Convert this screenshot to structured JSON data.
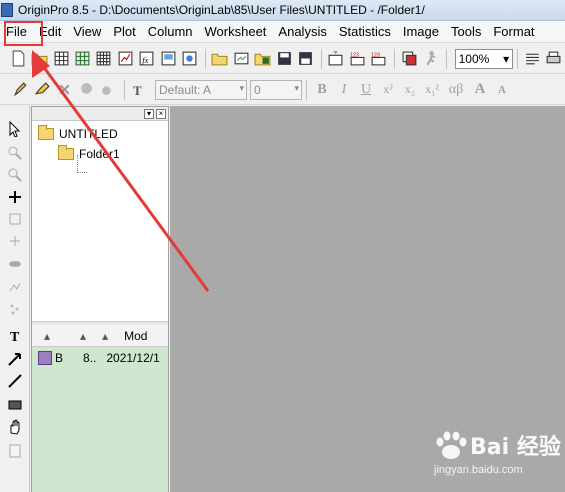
{
  "window": {
    "title": "OriginPro 8.5 - D:\\Documents\\OriginLab\\85\\User Files\\UNTITLED - /Folder1/"
  },
  "menu": {
    "items": [
      "File",
      "Edit",
      "View",
      "Plot",
      "Column",
      "Worksheet",
      "Analysis",
      "Statistics",
      "Image",
      "Tools",
      "Format"
    ]
  },
  "toolbar": {
    "zoom_value": "100%"
  },
  "format_toolbar": {
    "font_value": "Default: A",
    "size_value": "0",
    "bold": "B",
    "italic": "I",
    "underline": "U",
    "superscript": "x²",
    "subscript": "x₂",
    "supsub": "x₁²",
    "greek": "αβ",
    "font_size_up": "A",
    "font_size_down": "A"
  },
  "explorer": {
    "root": "UNTITLED",
    "folder": "Folder1",
    "columns": [
      "Mod"
    ],
    "items": [
      {
        "name": "B",
        "size": "8..",
        "modified": "2021/12/1"
      }
    ]
  },
  "watermark": {
    "brand": "Bai 经验",
    "site": "jingyan.baidu.com"
  },
  "colors": {
    "workspace": "#a9a9a9",
    "annotation": "#e53a3a",
    "list_bg": "#cfe6cf"
  }
}
